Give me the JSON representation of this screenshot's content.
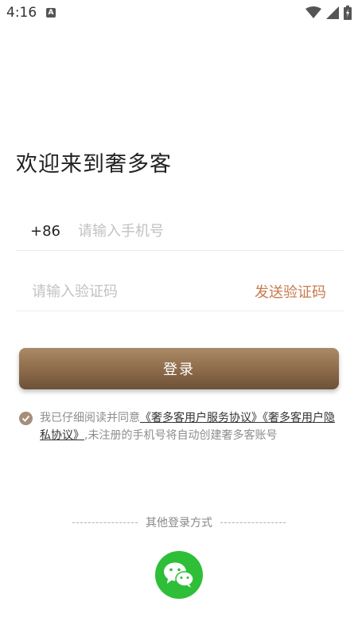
{
  "status_bar": {
    "time": "4:16",
    "notif_letter": "A"
  },
  "welcome": {
    "title": "欢迎来到奢多客"
  },
  "phone": {
    "country_code": "+86",
    "placeholder": "请输入手机号"
  },
  "code": {
    "placeholder": "请输入验证码",
    "send_label": "发送验证码"
  },
  "login_button": {
    "label": "登录"
  },
  "agreement": {
    "prefix": "我已仔细阅读并同意",
    "service_link": "《奢多客用户服务协议》",
    "privacy_link": "《奢多客用户隐私协议》",
    "suffix": ",未注册的手机号将自动创建奢多客账号"
  },
  "other_login": {
    "label": "其他登录方式"
  },
  "colors": {
    "accent": "#c87a4e",
    "button_top": "#ab8a67",
    "button_bottom": "#6d5137",
    "wechat": "#2fbe37"
  },
  "icons": {
    "wifi": "wifi-icon",
    "signal": "signal-icon",
    "battery": "battery-icon",
    "check": "check-icon",
    "wechat": "wechat-icon"
  }
}
